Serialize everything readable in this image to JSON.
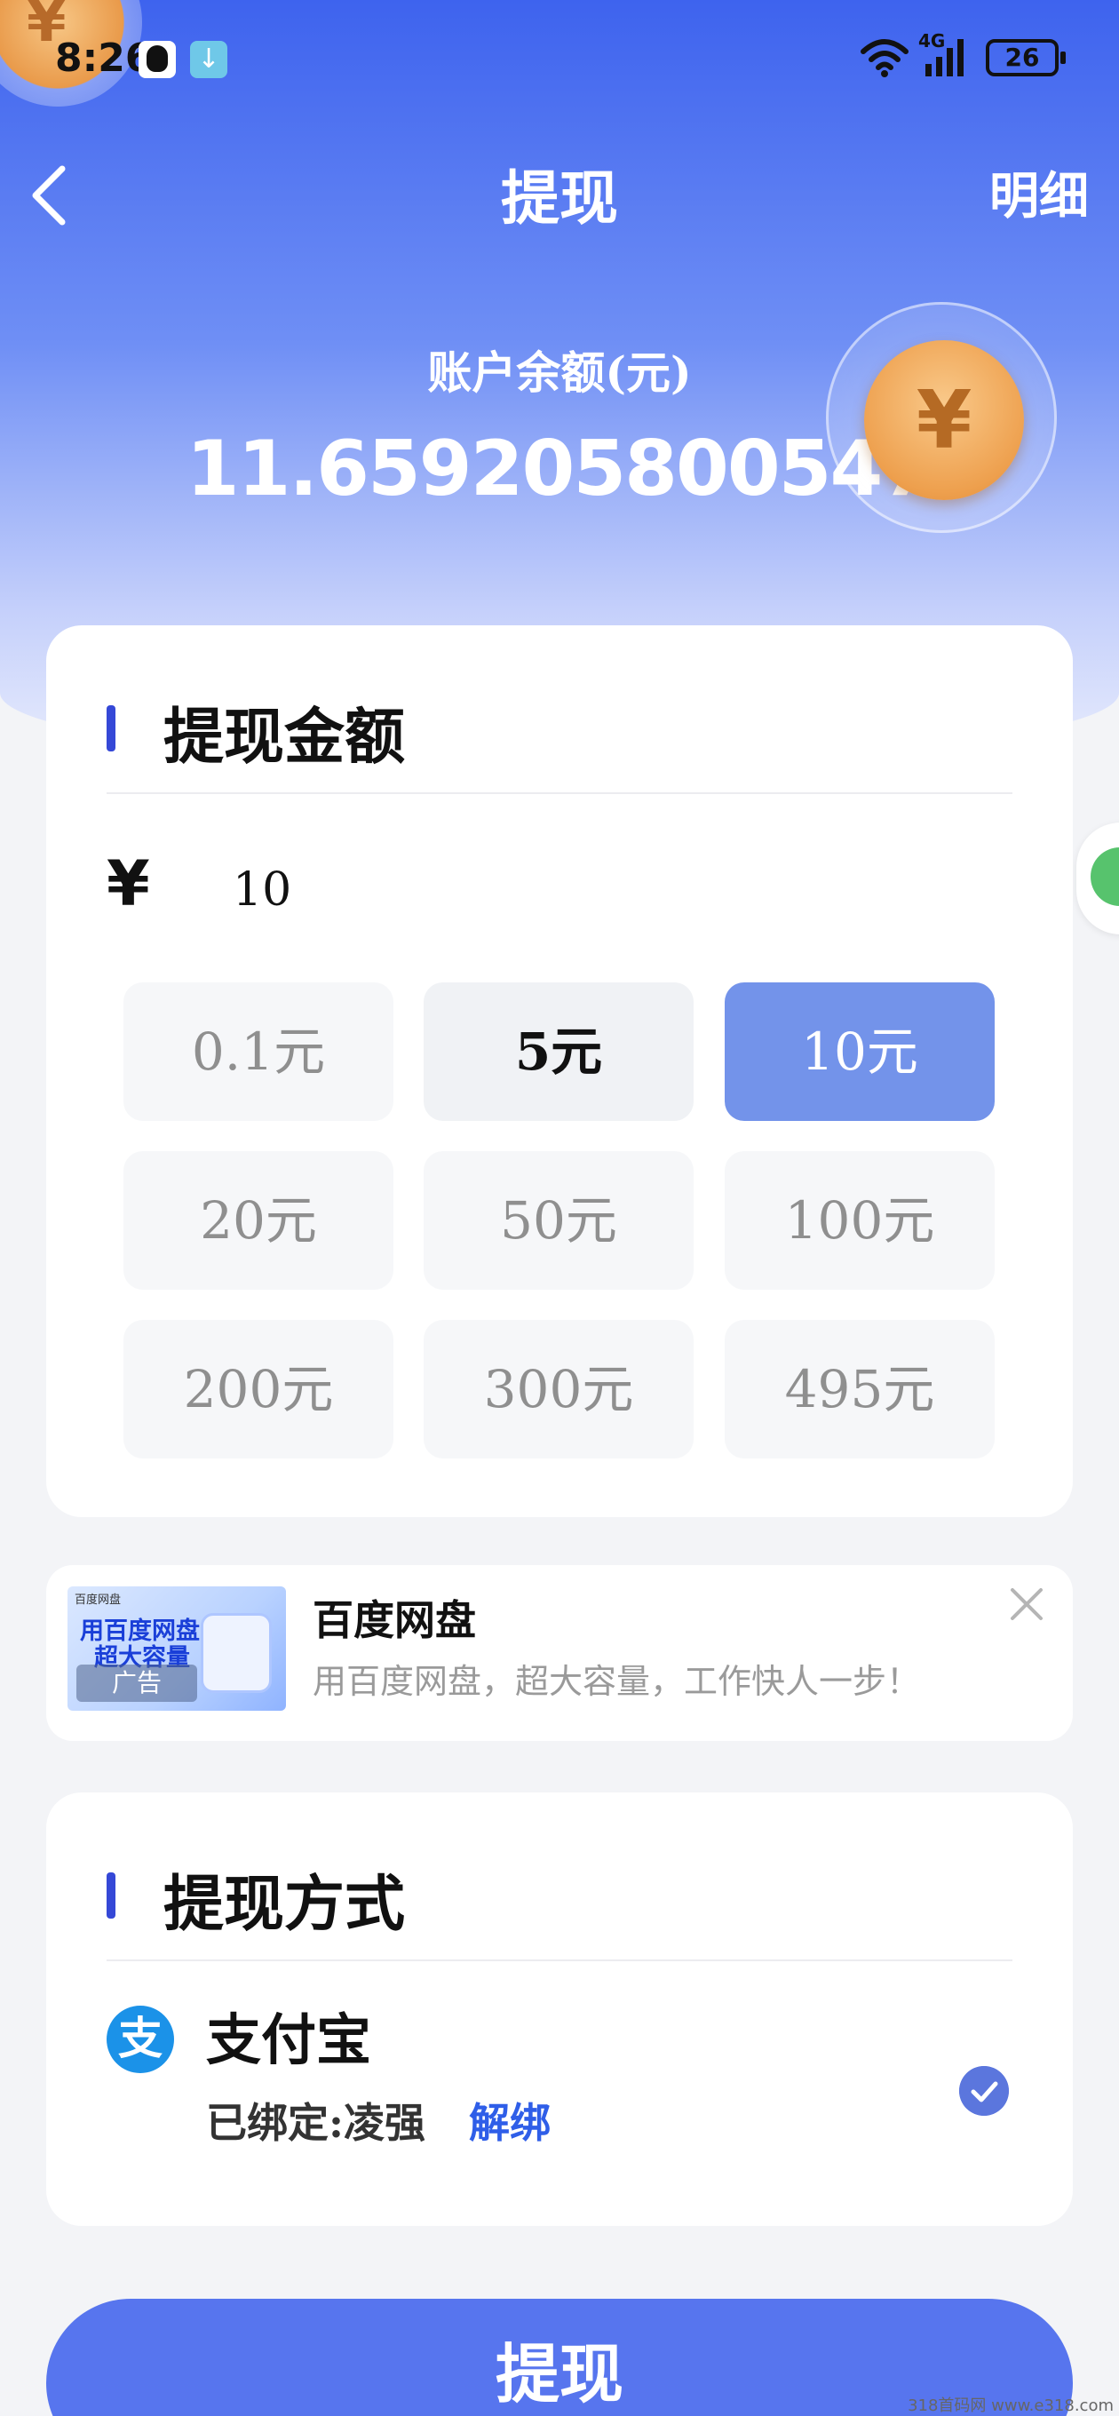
{
  "status_bar": {
    "time": "8:26",
    "network": "4G",
    "battery": "26"
  },
  "nav": {
    "title": "提现",
    "detail": "明细"
  },
  "balance": {
    "label": "账户余额(元)",
    "value": "11.659205800547"
  },
  "amount_section": {
    "title": "提现金额",
    "currency": "¥",
    "value": "10",
    "options": [
      {
        "label": "0.1元",
        "state": "disabled"
      },
      {
        "label": "5元",
        "state": "available"
      },
      {
        "label": "10元",
        "state": "selected"
      },
      {
        "label": "20元",
        "state": "disabled"
      },
      {
        "label": "50元",
        "state": "disabled"
      },
      {
        "label": "100元",
        "state": "disabled"
      },
      {
        "label": "200元",
        "state": "disabled"
      },
      {
        "label": "300元",
        "state": "disabled"
      },
      {
        "label": "495元",
        "state": "disabled"
      }
    ]
  },
  "ad": {
    "image_brand": "百度网盘",
    "image_line1": "用百度网盘",
    "image_line2": "超大容量",
    "image_tag": "广告",
    "title": "百度网盘",
    "description": "用百度网盘，超大容量，工作快人一步！"
  },
  "method_section": {
    "title": "提现方式",
    "icon_glyph": "支",
    "name": "支付宝",
    "bound": "已绑定:凌强",
    "unbind": "解绑",
    "selected": true
  },
  "submit": {
    "label": "提现"
  },
  "watermark": "318首码网  www.e318.com",
  "colors": {
    "primary": "#5775ee",
    "selected_option": "#7393ea",
    "accent_bar": "#3548d7",
    "link": "#2f5ee8"
  }
}
